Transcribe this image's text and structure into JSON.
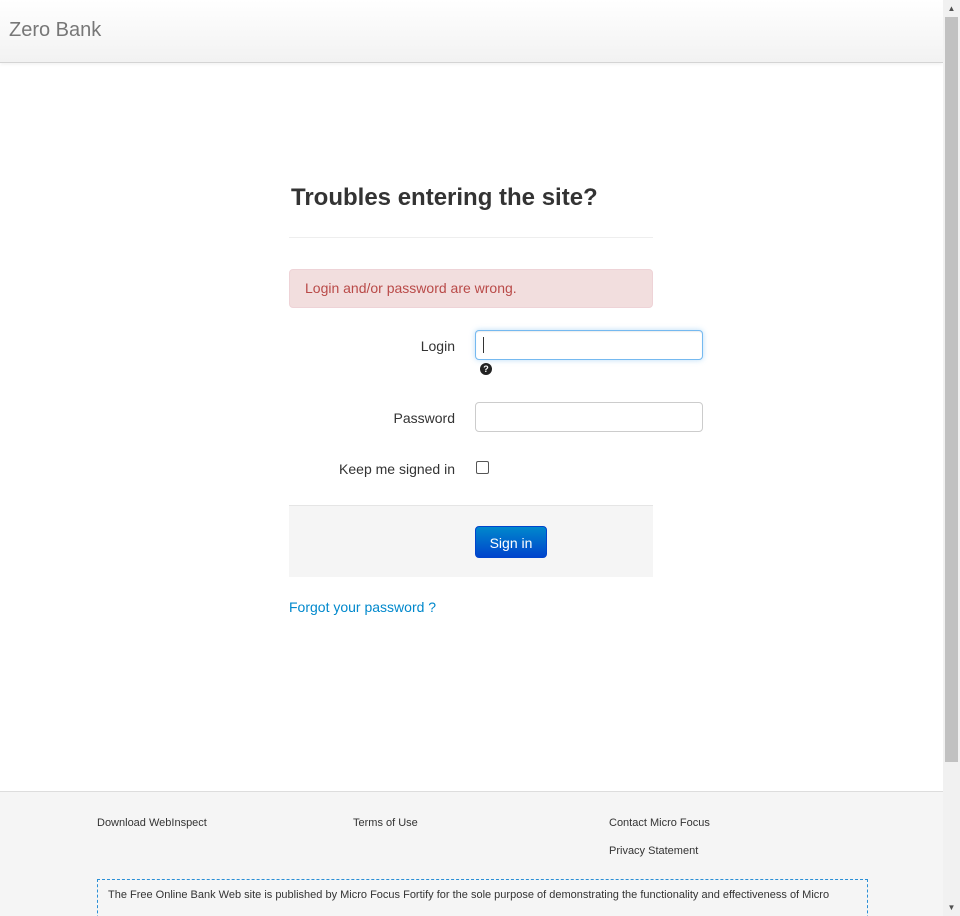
{
  "navbar": {
    "brand": "Zero Bank"
  },
  "login_page": {
    "title": "Troubles entering the site?",
    "error_message": "Login and/or password are wrong.",
    "login_label": "Login",
    "login_value": "",
    "help_icon": "question-circle-icon",
    "password_label": "Password",
    "password_value": "",
    "remember_label": "Keep me signed in",
    "remember_checked": false,
    "sign_in_label": "Sign in",
    "forgot_link": "Forgot your password ?"
  },
  "footer": {
    "download_link": "Download WebInspect",
    "terms_link": "Terms of Use",
    "contact_link": "Contact Micro Focus",
    "privacy_link": "Privacy Statement",
    "disclaimer": "The Free Online Bank Web site is published by Micro Focus Fortify for the sole purpose of demonstrating the functionality and effectiveness of Micro"
  },
  "colors": {
    "primary_button": "#0044cc",
    "error_background": "#f2dede",
    "error_text": "#b94a48",
    "link": "#0088cc"
  }
}
